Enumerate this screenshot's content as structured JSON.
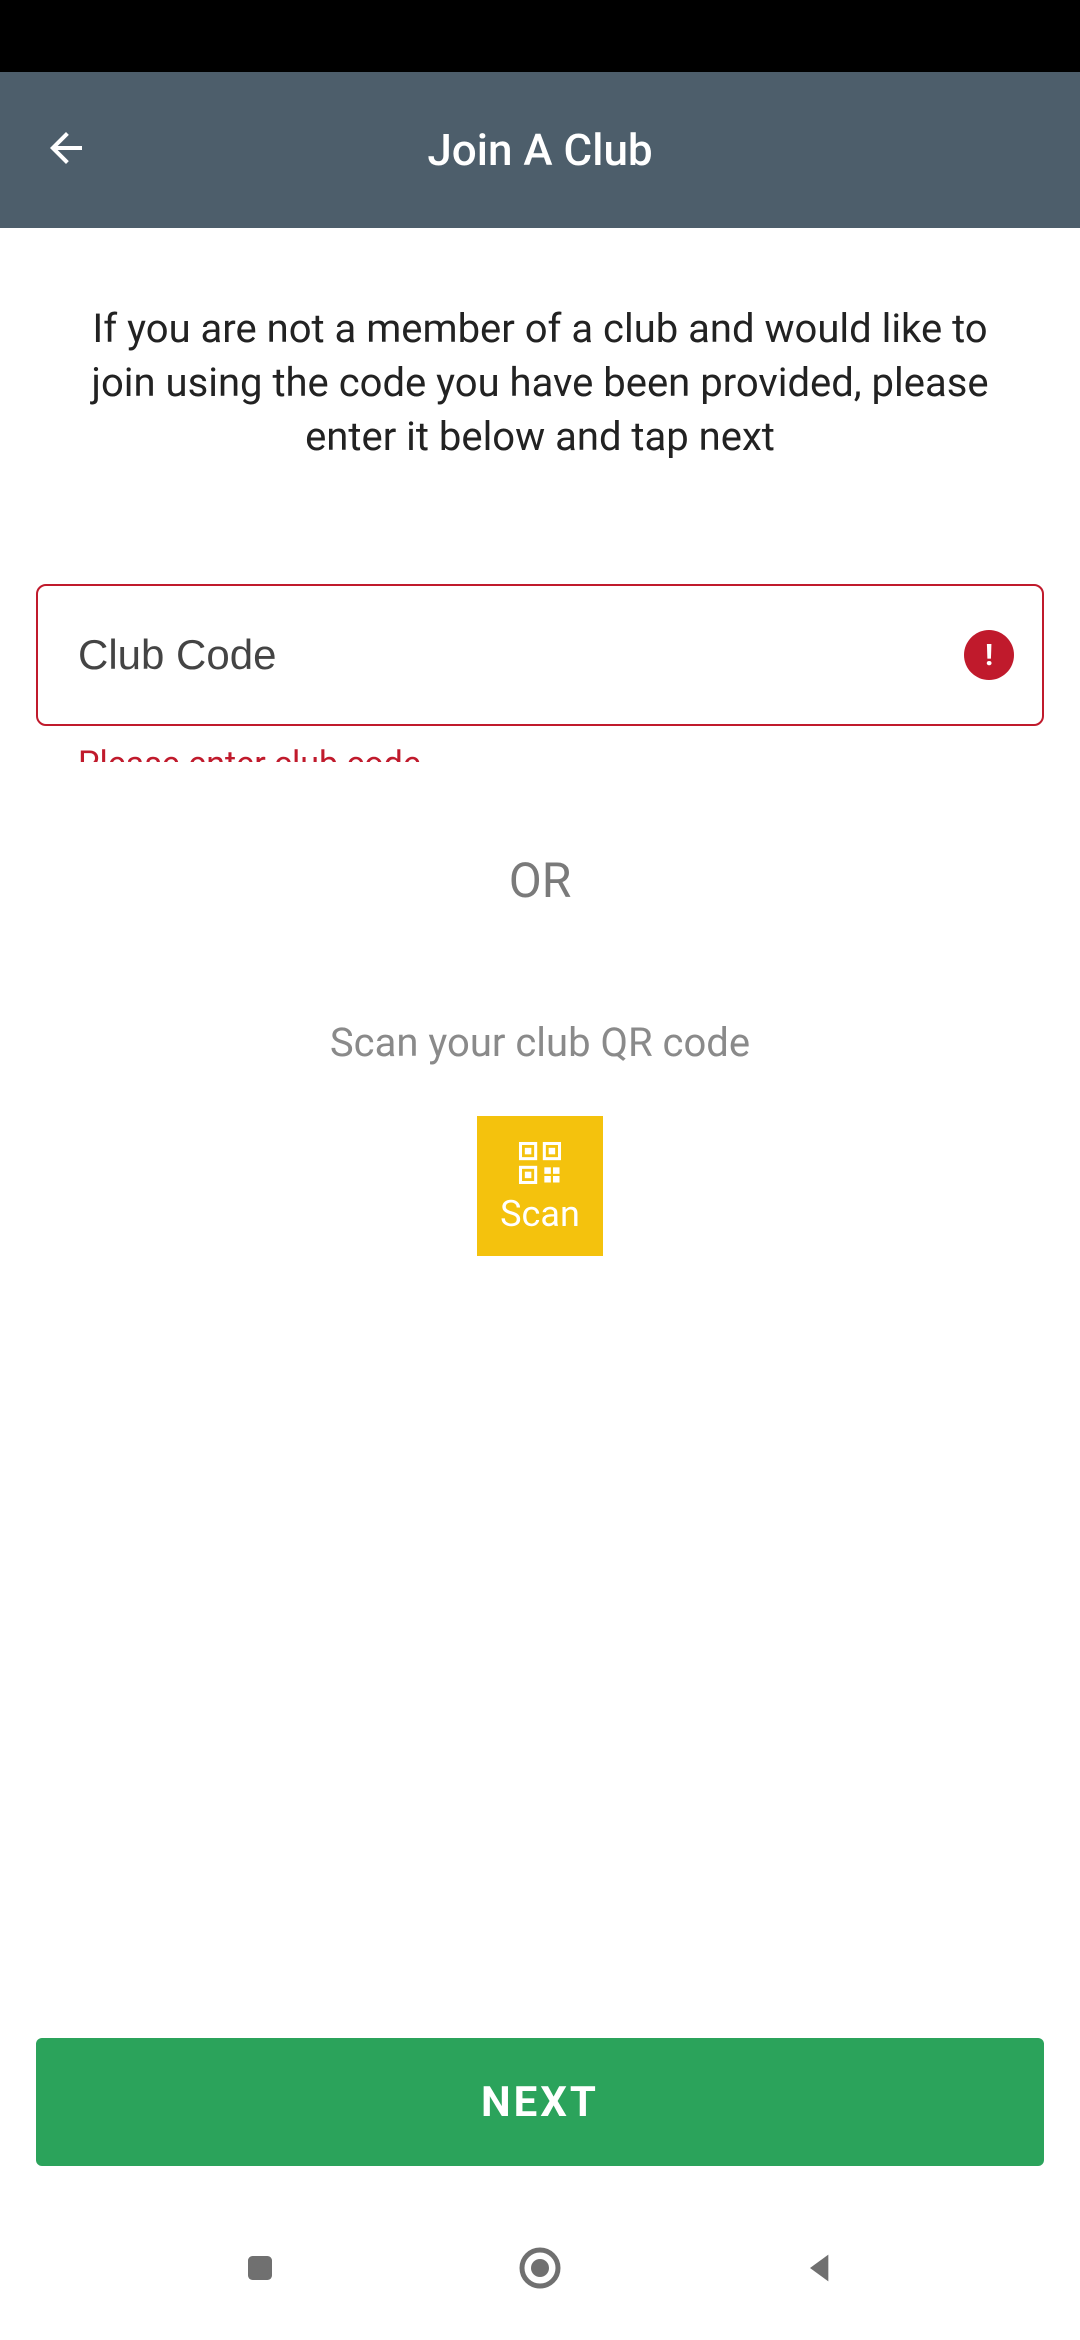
{
  "header": {
    "title": "Join A Club"
  },
  "instructions": "If you are not a member of a club and would like to join using the code you have been provided, please enter it below and tap next",
  "input": {
    "placeholder": "Club Code",
    "value": "",
    "error_text": "Please enter club code",
    "error_icon_glyph": "!"
  },
  "separator": "OR",
  "scan": {
    "prompt": "Scan your club QR code",
    "button_label": "Scan"
  },
  "next_button": "NEXT",
  "colors": {
    "appbar": "#4d5e6b",
    "error": "#c01a2c",
    "scan_button": "#f4c20d",
    "next_button": "#2ba35b"
  }
}
